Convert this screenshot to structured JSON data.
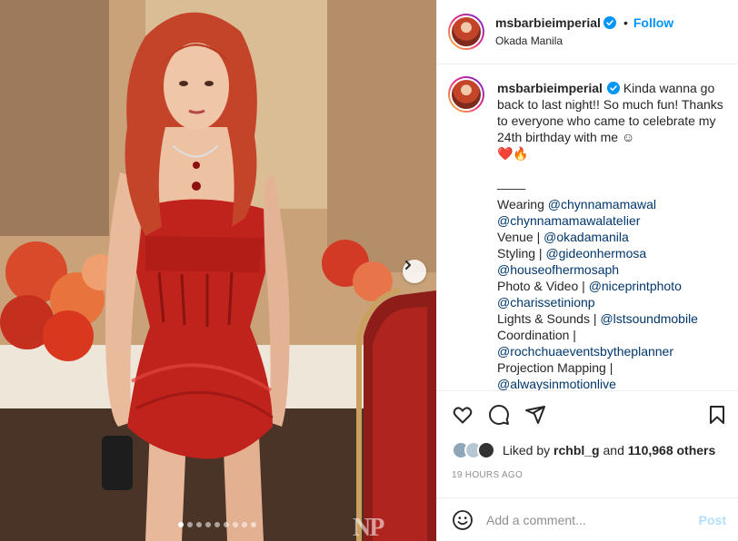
{
  "post": {
    "username": "msbarbieimperial",
    "verified": true,
    "follow_label": "Follow",
    "bullet": "•",
    "location": "Okada Manila"
  },
  "caption": {
    "username": "msbarbieimperial",
    "text": "Kinda wanna go back to last night!! So much fun! Thanks to everyone who came to celebrate my 24th birthday with me ☺",
    "emojis": "❤️🔥",
    "divider": "____",
    "lines": [
      {
        "prefix": "Wearing ",
        "mention": "@chynnamamawal"
      },
      {
        "prefix": "",
        "mention": "@chynnamamawalatelier"
      },
      {
        "prefix": "Venue | ",
        "mention": "@okadamanila"
      },
      {
        "prefix": "Styling | ",
        "mention": "@gideonhermosa"
      },
      {
        "prefix": "",
        "mention": "@houseofhermosaph"
      },
      {
        "prefix": "Photo & Video | ",
        "mention": "@niceprintphoto"
      },
      {
        "prefix": "",
        "mention": "@charissetinionp"
      },
      {
        "prefix": "Lights & Sounds | ",
        "mention": "@lstsoundmobile"
      },
      {
        "prefix": "Coordination |",
        "mention": ""
      },
      {
        "prefix": "",
        "mention": "@rochchuaeventsbytheplanner"
      },
      {
        "prefix": "Projection Mapping |",
        "mention": ""
      },
      {
        "prefix": "",
        "mention": "@alwaysinmotionlive"
      }
    ]
  },
  "actions": {
    "like_icon": "heart-icon",
    "comment_icon": "comment-icon",
    "share_icon": "paper-plane-icon",
    "save_icon": "bookmark-icon"
  },
  "likes": {
    "liked_by_prefix": "Liked by",
    "liked_by_user": "rchbl_g",
    "and": "and",
    "others_count": "110,968 others"
  },
  "time_ago": "19 HOURS AGO",
  "comment": {
    "placeholder": "Add a comment...",
    "post_label": "Post"
  },
  "carousel": {
    "dot_count": 9,
    "active_index": 0
  },
  "photo": {
    "watermark": "NP"
  },
  "colors": {
    "accent_blue": "#0095f6",
    "mention": "#00376b",
    "dress_red": "#c0221c",
    "hair": "#c4442a",
    "post_disabled": "#b2dffc"
  }
}
